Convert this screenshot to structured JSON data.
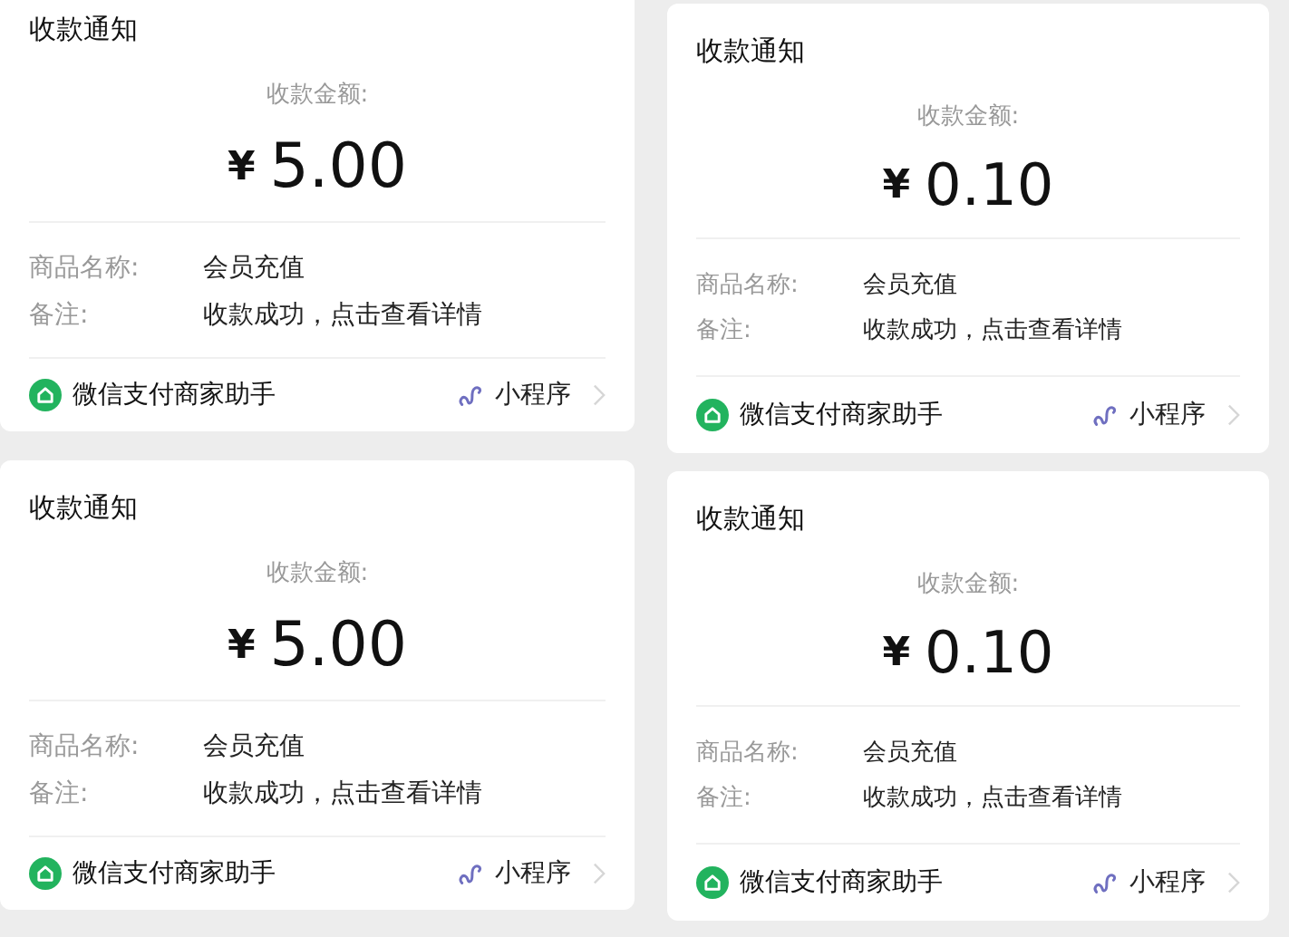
{
  "columns": [
    {
      "cards": [
        {
          "title": "收款通知",
          "amount_label": "收款金额:",
          "currency": "¥",
          "amount": "5.00",
          "fields": [
            {
              "label": "商品名称:",
              "value": "会员充值"
            },
            {
              "label": "备注:",
              "value": "收款成功，点击查看详情"
            }
          ],
          "footer": {
            "source": "微信支付商家助手",
            "link": "小程序"
          }
        },
        {
          "title": "收款通知",
          "amount_label": "收款金额:",
          "currency": "¥",
          "amount": "5.00",
          "fields": [
            {
              "label": "商品名称:",
              "value": "会员充值"
            },
            {
              "label": "备注:",
              "value": "收款成功，点击查看详情"
            }
          ],
          "footer": {
            "source": "微信支付商家助手",
            "link": "小程序"
          }
        }
      ]
    },
    {
      "cards": [
        {
          "title": "收款通知",
          "amount_label": "收款金额:",
          "currency": "¥",
          "amount": "0.10",
          "fields": [
            {
              "label": "商品名称:",
              "value": "会员充值"
            },
            {
              "label": "备注:",
              "value": "收款成功，点击查看详情"
            }
          ],
          "footer": {
            "source": "微信支付商家助手",
            "link": "小程序"
          }
        },
        {
          "title": "收款通知",
          "amount_label": "收款金额:",
          "currency": "¥",
          "amount": "0.10",
          "fields": [
            {
              "label": "商品名称:",
              "value": "会员充值"
            },
            {
              "label": "备注:",
              "value": "收款成功，点击查看详情"
            }
          ],
          "footer": {
            "source": "微信支付商家助手",
            "link": "小程序"
          }
        }
      ]
    }
  ]
}
